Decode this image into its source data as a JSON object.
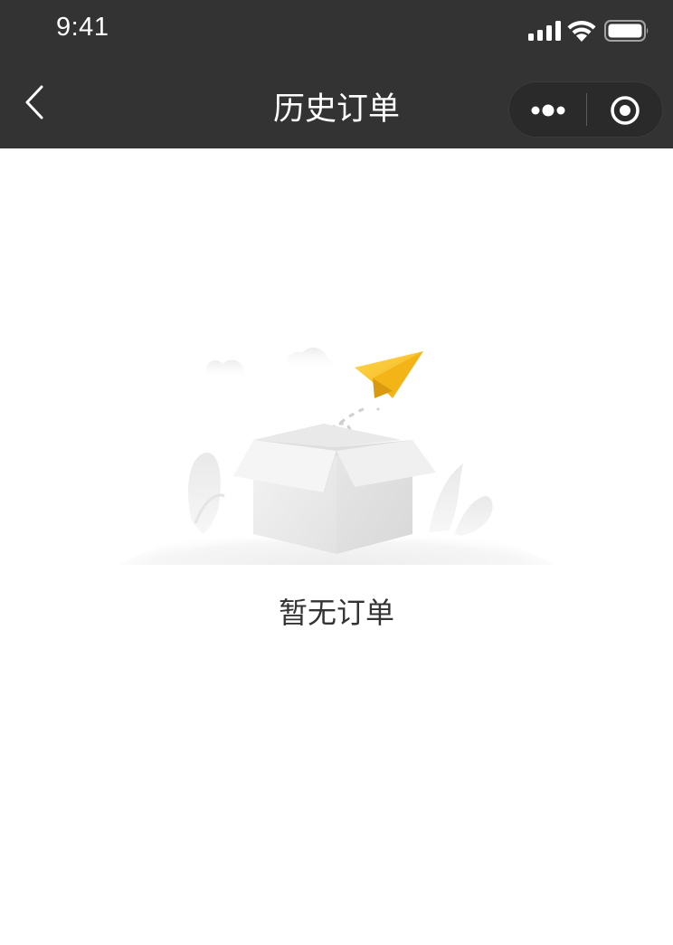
{
  "status_bar": {
    "time": "9:41",
    "icons": [
      "signal-icon",
      "wifi-icon",
      "battery-icon"
    ]
  },
  "nav_bar": {
    "title": "历史订单",
    "back_icon": "chevron-left-icon",
    "capsule": {
      "more_icon": "more-dots-icon",
      "close_icon": "target-circle-icon"
    }
  },
  "main": {
    "empty_state": {
      "illustration": "empty-box-paper-plane-illustration",
      "message": "暂无订单"
    }
  },
  "colors": {
    "bar_background": "#333333",
    "page_background": "#ffffff",
    "text_primary": "#333333",
    "plane_yellow": "#f7c325"
  }
}
